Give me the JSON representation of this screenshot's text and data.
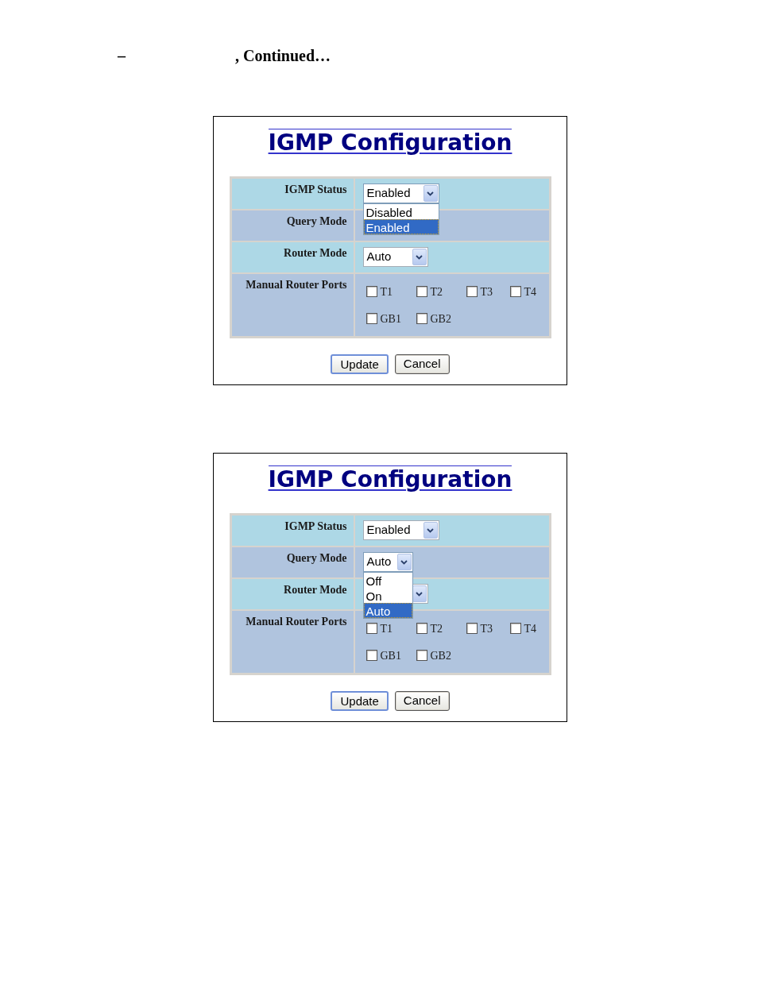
{
  "header": {
    "dash": "–",
    "text": ", Continued…"
  },
  "panels": [
    {
      "title": "IGMP Configuration",
      "fields": [
        {
          "label": "IGMP Status",
          "kind": "select",
          "value": "Enabled",
          "open": true,
          "options": [
            {
              "label": "Disabled",
              "selected": false
            },
            {
              "label": "Enabled",
              "selected": true
            }
          ]
        },
        {
          "label": "Query Mode",
          "kind": "empty"
        },
        {
          "label": "Router Mode",
          "kind": "select",
          "value": "Auto",
          "open": false
        },
        {
          "label": "Manual Router Ports",
          "kind": "ports",
          "rows": [
            [
              {
                "label": "T1",
                "checked": false
              },
              {
                "label": "T2",
                "checked": false
              },
              {
                "label": "T3",
                "checked": false
              },
              {
                "label": "T4",
                "checked": false
              }
            ],
            [
              {
                "label": "GB1",
                "checked": false
              },
              {
                "label": "GB2",
                "checked": false
              }
            ]
          ]
        }
      ],
      "buttons": [
        {
          "label": "Update",
          "focused": true
        },
        {
          "label": "Cancel",
          "focused": false
        }
      ]
    },
    {
      "title": "IGMP Configuration",
      "fields": [
        {
          "label": "IGMP Status",
          "kind": "select",
          "value": "Enabled",
          "open": false
        },
        {
          "label": "Query Mode",
          "kind": "select",
          "value": "Auto",
          "open": true,
          "options": [
            {
              "label": "Off",
              "selected": false
            },
            {
              "label": "On",
              "selected": false
            },
            {
              "label": "Auto",
              "selected": true
            }
          ]
        },
        {
          "label": "Router Mode",
          "kind": "select",
          "open": false
        },
        {
          "label": "Manual Router Ports",
          "kind": "ports",
          "rows": [
            [
              {
                "label": "T1",
                "checked": false
              },
              {
                "label": "T2",
                "checked": false
              },
              {
                "label": "T3",
                "checked": false
              },
              {
                "label": "T4",
                "checked": false
              }
            ],
            [
              {
                "label": "GB1",
                "checked": false
              },
              {
                "label": "GB2",
                "checked": false
              }
            ]
          ]
        }
      ],
      "buttons": [
        {
          "label": "Update",
          "focused": true
        },
        {
          "label": "Cancel",
          "focused": false
        }
      ]
    }
  ]
}
